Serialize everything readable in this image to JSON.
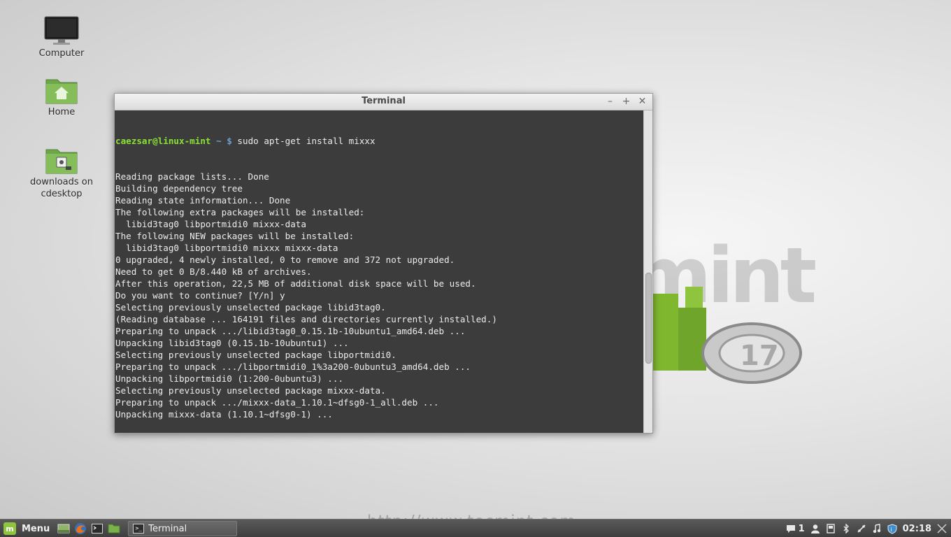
{
  "desktop": {
    "icons": [
      {
        "label": "Computer"
      },
      {
        "label": "Home"
      },
      {
        "label": "downloads on cdesktop"
      }
    ]
  },
  "terminal": {
    "title": "Terminal",
    "prompt_user": "caezsar@linux-mint",
    "prompt_path": " ~ $ ",
    "command": "sudo apt-get install mixxx",
    "output": [
      "Reading package lists... Done",
      "Building dependency tree",
      "Reading state information... Done",
      "The following extra packages will be installed:",
      "  libid3tag0 libportmidi0 mixxx-data",
      "The following NEW packages will be installed:",
      "  libid3tag0 libportmidi0 mixxx mixxx-data",
      "0 upgraded, 4 newly installed, 0 to remove and 372 not upgraded.",
      "Need to get 0 B/8.440 kB of archives.",
      "After this operation, 22,5 MB of additional disk space will be used.",
      "Do you want to continue? [Y/n] y",
      "Selecting previously unselected package libid3tag0.",
      "(Reading database ... 164191 files and directories currently installed.)",
      "Preparing to unpack .../libid3tag0_0.15.1b-10ubuntu1_amd64.deb ...",
      "Unpacking libid3tag0 (0.15.1b-10ubuntu1) ...",
      "Selecting previously unselected package libportmidi0.",
      "Preparing to unpack .../libportmidi0_1%3a200-0ubuntu3_amd64.deb ...",
      "Unpacking libportmidi0 (1:200-0ubuntu3) ...",
      "Selecting previously unselected package mixxx-data.",
      "Preparing to unpack .../mixxx-data_1.10.1~dfsg0-1_all.deb ...",
      "Unpacking mixxx-data (1.10.1~dfsg0-1) ..."
    ],
    "scroll_position": 0.7
  },
  "wallpaper": {
    "brand_text": "linuxmint",
    "version_badge": "17"
  },
  "watermark": "http://www.tecmint.com",
  "taskbar": {
    "menu_label": "Menu",
    "launchers": [
      "desktop-icon",
      "firefox-icon",
      "terminal-icon",
      "files-icon"
    ],
    "window_label": "Terminal",
    "notification_count": "1",
    "clock": "02:18"
  },
  "colors": {
    "prompt_user": "#8ae234",
    "prompt_path": "#729fcf",
    "terminal_bg": "#3c3c3c",
    "mint_green": "#8fc43f"
  }
}
